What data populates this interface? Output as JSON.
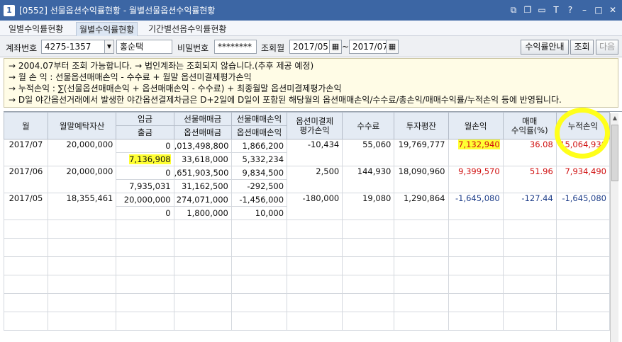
{
  "window": {
    "number": "1",
    "title": "[0552] 선물옵션수익률현황 - 월별선물옵션수익률현황",
    "icons": [
      "window-restore-icon",
      "copy-icon",
      "pin-icon",
      "font-icon",
      "help-icon",
      "minimize-icon",
      "maximize-icon",
      "close-icon"
    ]
  },
  "tabs": [
    {
      "label": "일별수익률현황",
      "active": false
    },
    {
      "label": "월별수익률현황",
      "active": true
    },
    {
      "label": "기간별선옵수익률현황",
      "active": false
    }
  ],
  "filter": {
    "account_label": "계좌번호",
    "account_value": "4275-1357",
    "owner_name": "홍순택",
    "password_label": "비밀번호",
    "password_value": "********",
    "month_label": "조회월",
    "start_month": "2017/05",
    "tilde": "~",
    "end_month": "2017/07",
    "guide_button": "수익률안내",
    "search_button": "조회",
    "next_button": "다음"
  },
  "notice": [
    "→ 2004.07부터 조회 가능합니다. → 법인계좌는 조회되지 않습니다.(추후 제공 예정)",
    "→ 월 손 익 : 선물옵션매매손익 - 수수료 + 월말 옵션미결제평가손익",
    "→ 누적손익 : ∑(선물옵션매매손익 + 옵션매매손익 - 수수료) + 최종월말 옵션미결제평가손익",
    "→ D일 야간옵선거래에서 발생한 야간옵션결제차금은 D+2일에 D일이 포함된 해당월의 옵션매매손익/수수료/총손익/매매수익률/누적손익 등에 반영됩니다."
  ],
  "table": {
    "headers": {
      "month": "월",
      "assets": "월말예탁자산",
      "deposit": "입금",
      "withdraw": "출금",
      "fut_amt": "선물매매금",
      "opt_amt": "옵션매매금",
      "fut_pl": "선물매매손익",
      "opt_pl": "옵션매매손익",
      "unsettled_1": "옵션미결제",
      "unsettled_2": "평가손익",
      "fee": "수수료",
      "avg_invest": "투자평잔",
      "monthly_pl": "월손익",
      "trade_return_1": "매매",
      "trade_return_2": "수익률(%)",
      "cum_pl": "누적손익"
    },
    "rows": [
      {
        "month": "2017/07",
        "assets": "20,000,000",
        "deposit": "0",
        "withdraw": "7,136,908",
        "fut_amt": ",013,498,800",
        "opt_amt": "33,618,000",
        "fut_pl": "1,866,200",
        "opt_pl": "5,332,234",
        "unsettled": "-10,434",
        "fee": "55,060",
        "avg_invest": "19,769,777",
        "monthly_pl": "7,132,940",
        "trade_return": "36.08",
        "cum_pl": "15,064,930"
      },
      {
        "month": "2017/06",
        "assets": "20,000,000",
        "deposit": "0",
        "withdraw": "7,935,031",
        "fut_amt": ",651,903,500",
        "opt_amt": "31,162,500",
        "fut_pl": "9,834,500",
        "opt_pl": "-292,500",
        "unsettled": "2,500",
        "fee": "144,930",
        "avg_invest": "18,090,960",
        "monthly_pl": "9,399,570",
        "trade_return": "51.96",
        "cum_pl": "7,934,490"
      },
      {
        "month": "2017/05",
        "assets": "18,355,461",
        "deposit": "20,000,000",
        "withdraw": "0",
        "fut_amt": "274,071,000",
        "opt_amt": "1,800,000",
        "fut_pl": "-1,456,000",
        "opt_pl": "10,000",
        "unsettled": "-180,000",
        "fee": "19,080",
        "avg_invest": "1,290,864",
        "monthly_pl": "-1,645,080",
        "trade_return": "-127.44",
        "cum_pl": "-1,645,080"
      }
    ]
  },
  "colors": {
    "titlebar": "#3c66a4",
    "highlight": "#ffff33",
    "positive": "#d01010",
    "negative": "#1f3f8a"
  }
}
